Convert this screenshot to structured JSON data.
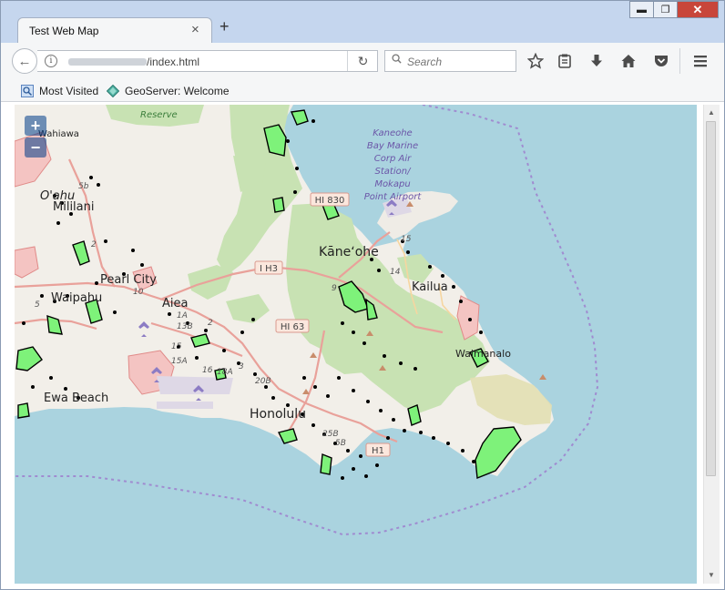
{
  "window": {
    "minimize_label": "▬",
    "maximize_label": "❐",
    "close_label": "✕"
  },
  "tab": {
    "title": "Test Web Map",
    "close_label": "×",
    "new_tab_label": "+"
  },
  "nav": {
    "url_visible": "/index.html",
    "search_placeholder": "Search"
  },
  "bookmarks": [
    {
      "label": "Most Visited"
    },
    {
      "label": "GeoServer: Welcome"
    }
  ],
  "map": {
    "zoom_in": "+",
    "zoom_out": "−",
    "colors": {
      "water": "#aad3df",
      "land": "#f2efe9",
      "park": "#c8e2b3",
      "polygon": "#7ef27a",
      "military": "#f4c4c2",
      "road": "#e9a19a",
      "boundary": "#a08bd0"
    },
    "labels": {
      "reserve": "Reserve",
      "wahiawa": "Wahiawa",
      "oahu": "O'ahu",
      "mililani": "Mililani",
      "pearl_city": "Pearl City",
      "waipahu": "Waipahu",
      "aiea": "Aiea",
      "ewa_beach": "Ewa Beach",
      "honolulu": "Honolulu",
      "kaneohe": "Kāneʻohe",
      "kailua": "Kailua",
      "waimanalo": "Waimanalo",
      "marine_1": "Kaneohe",
      "marine_2": "Bay Marine",
      "marine_3": "Corp Air",
      "marine_4": "Station/",
      "marine_5": "Mokapu",
      "marine_6": "Point Airport"
    },
    "shields": {
      "hi830": "HI 830",
      "ih3": "I H3",
      "hi63": "HI 63",
      "h1": "H1"
    },
    "route_numbers": {
      "r5b": "5b",
      "r2": "2",
      "r10": "10",
      "r5": "5",
      "r1a": "1A",
      "r13b": "13B",
      "r2b": "2",
      "r15a": "15",
      "r15b": "15A",
      "r16": "16",
      "r18a": "18A",
      "r3": "3",
      "r20b": "20B",
      "r25b": "25B",
      "r5b2": "5B",
      "r15c": "15",
      "r14": "14",
      "r9": "9"
    }
  }
}
